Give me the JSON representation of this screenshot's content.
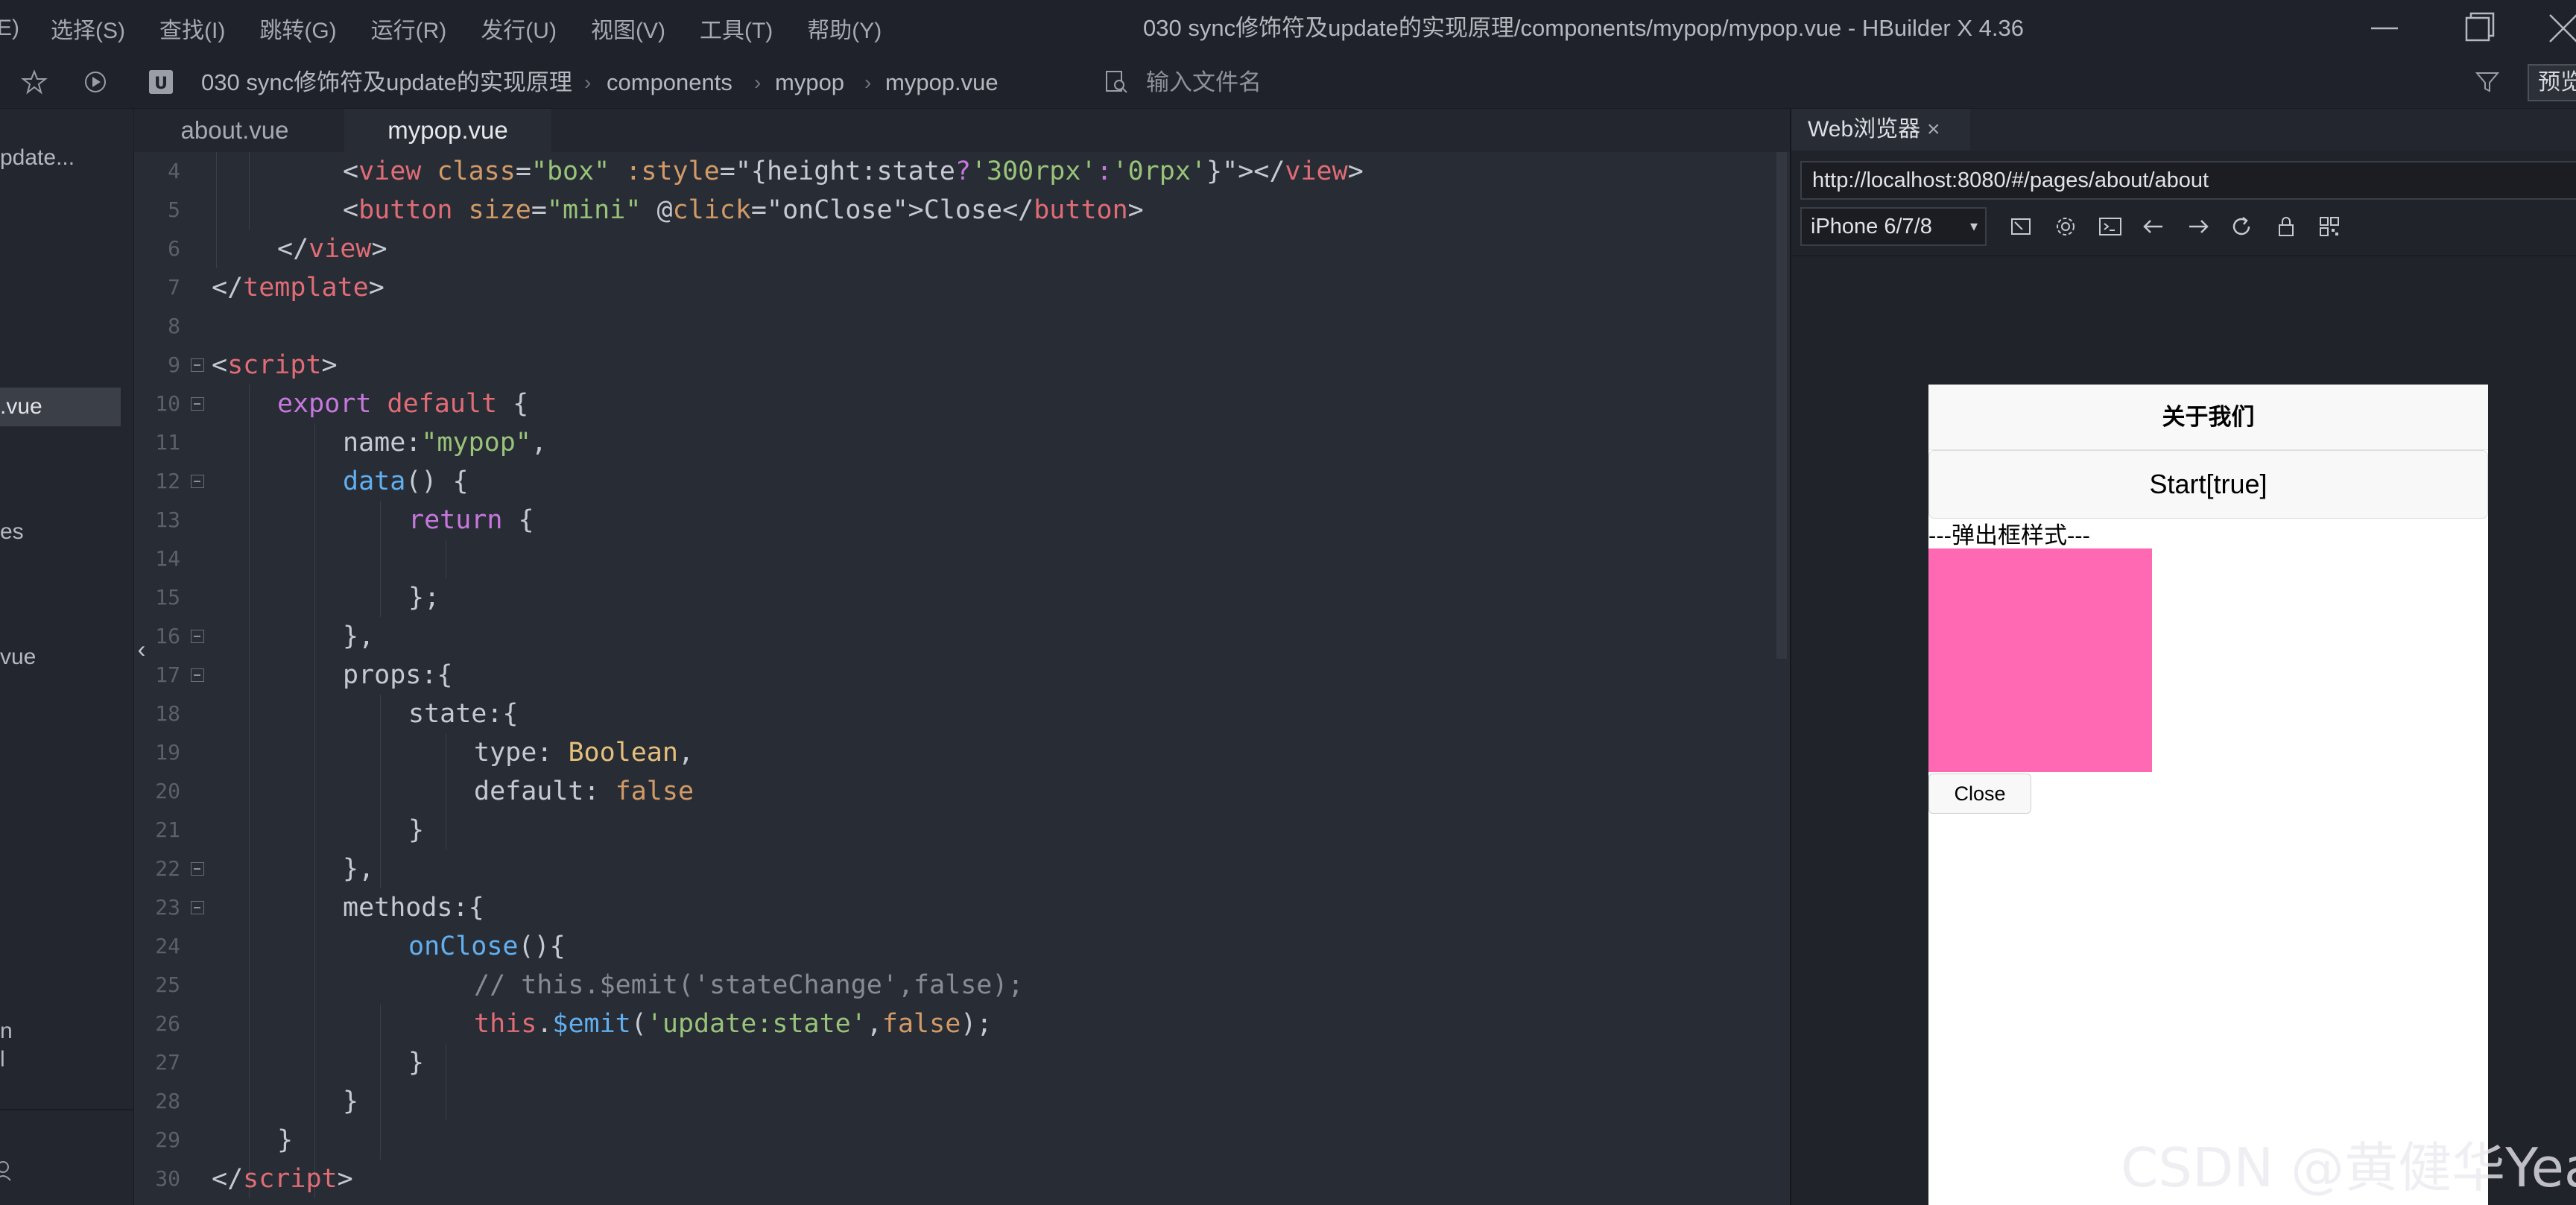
{
  "menubar": {
    "items": [
      "E)",
      "选择(S)",
      "查找(I)",
      "跳转(G)",
      "运行(R)",
      "发行(U)",
      "视图(V)",
      "工具(T)",
      "帮助(Y)"
    ],
    "window_title": "030 sync修饰符及update的实现原理/components/mypop/mypop.vue - HBuilder X 4.36"
  },
  "breadcrumb": {
    "items": [
      "030 sync修饰符及update的实现原理",
      "components",
      "mypop",
      "mypop.vue"
    ],
    "separator": "›",
    "filename_placeholder": "输入文件名",
    "preview_label": "预览"
  },
  "sidebar": {
    "items": [
      {
        "label": "pdate...",
        "active": false
      },
      {
        "label": ".vue",
        "active": true
      },
      {
        "label": "es",
        "active": false
      },
      {
        "label": "vue",
        "active": false
      },
      {
        "label": "n",
        "active": false
      },
      {
        "label": "l",
        "active": false
      }
    ],
    "collapse_glyph": "‹"
  },
  "editor": {
    "tabs": [
      {
        "label": "about.vue",
        "active": false
      },
      {
        "label": "mypop.vue",
        "active": true
      }
    ],
    "line_numbers": [
      "4",
      "5",
      "6",
      "7",
      "8",
      "9",
      "10",
      "11",
      "12",
      "13",
      "14",
      "15",
      "16",
      "17",
      "18",
      "19",
      "20",
      "21",
      "22",
      "23",
      "24",
      "25",
      "26",
      "27",
      "28",
      "29",
      "30"
    ],
    "code": {
      "l4": [
        "<",
        "view",
        " ",
        "class",
        "=",
        "\"box\"",
        " ",
        ":style",
        "=",
        "\"{height:state",
        "?",
        "'300rpx'",
        ":",
        "'0rpx'",
        "}\"",
        "></",
        "view",
        ">"
      ],
      "l5": [
        "<",
        "button",
        " ",
        "size",
        "=",
        "\"mini\"",
        " ",
        "@",
        "click",
        "=",
        "\"onClose\"",
        ">Close</",
        "button",
        ">"
      ],
      "l6": [
        "</",
        "view",
        ">"
      ],
      "l7": [
        "</",
        "template",
        ">"
      ],
      "l9": [
        "<",
        "script",
        ">"
      ],
      "l10": [
        "export",
        " ",
        "default",
        " {"
      ],
      "l11": [
        "name:",
        "\"mypop\"",
        ","
      ],
      "l12": [
        "data",
        "() {"
      ],
      "l13": [
        "return",
        " {"
      ],
      "l15": [
        "};"
      ],
      "l16": [
        "},"
      ],
      "l17": [
        "props:{"
      ],
      "l18": [
        "state:{"
      ],
      "l19": [
        "type: ",
        "Boolean",
        ","
      ],
      "l20": [
        "default: ",
        "false"
      ],
      "l21": [
        "}"
      ],
      "l22": [
        "},"
      ],
      "l23": [
        "methods:{"
      ],
      "l24": [
        "onClose",
        "(){"
      ],
      "l25": [
        "// this.$emit('stateChange',false);"
      ],
      "l26": [
        "this",
        ".",
        "$emit",
        "(",
        "'update:state'",
        ",",
        "false",
        ");"
      ],
      "l27": [
        "}"
      ],
      "l28": [
        "}"
      ],
      "l29": [
        "}"
      ],
      "l30": [
        "</",
        "script",
        ">"
      ]
    }
  },
  "browser": {
    "tab_label": "Web浏览器",
    "tab_close": "×",
    "url": "http://localhost:8080/#/pages/about/about",
    "device": "iPhone 6/7/8",
    "page": {
      "nav_title": "关于我们",
      "start_button": "Start[true]",
      "popup_label": "---弹出框样式---",
      "close_button": "Close",
      "popup_color": "#ff69b4"
    }
  },
  "watermark": "CSDN @黄健华Yeah",
  "colors": {
    "tag": "#e06c75",
    "attr": "#d19a66",
    "string": "#98c379",
    "keyword": "#c678dd",
    "function": "#61afef",
    "comment": "#868b94"
  }
}
